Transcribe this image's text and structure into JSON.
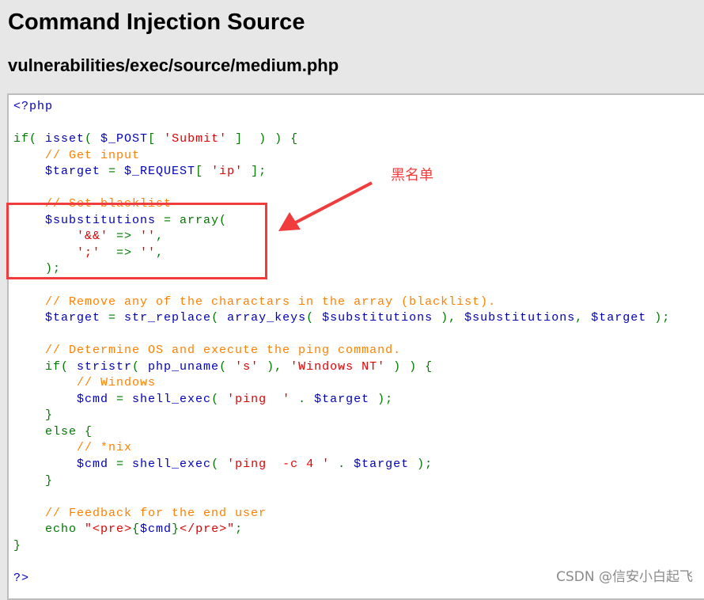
{
  "page": {
    "title": "Command Injection Source",
    "subtitle": "vulnerabilities/exec/source/medium.php"
  },
  "colors": {
    "keyword": "#007700",
    "default": "#0000bb",
    "string": "#dd0000",
    "comment": "#ff8000",
    "annotation": "#f03c3c"
  },
  "code": [
    [
      [
        "<?php",
        "blue"
      ]
    ],
    [],
    [
      [
        "if( ",
        "green"
      ],
      [
        "isset",
        "blue"
      ],
      [
        "( ",
        "green"
      ],
      [
        "$_POST",
        "blue"
      ],
      [
        "[ ",
        "green"
      ],
      [
        "'Submit'",
        "red"
      ],
      [
        " ]  ) ) {",
        "green"
      ]
    ],
    [
      [
        "    // Get input",
        "orange"
      ]
    ],
    [
      [
        "    $target ",
        "blue"
      ],
      [
        "= ",
        "green"
      ],
      [
        "$_REQUEST",
        "blue"
      ],
      [
        "[ ",
        "green"
      ],
      [
        "'ip'",
        "red"
      ],
      [
        " ];",
        "green"
      ]
    ],
    [],
    [
      [
        "    // Set blacklist",
        "orange"
      ]
    ],
    [
      [
        "    $substitutions ",
        "blue"
      ],
      [
        "= array(",
        "green"
      ]
    ],
    [
      [
        "        '&&' ",
        "red"
      ],
      [
        "=> ",
        "green"
      ],
      [
        "''",
        "red"
      ],
      [
        ",",
        "green"
      ]
    ],
    [
      [
        "        ';'  ",
        "red"
      ],
      [
        "=> ",
        "green"
      ],
      [
        "''",
        "red"
      ],
      [
        ",",
        "green"
      ]
    ],
    [
      [
        "    );",
        "green"
      ]
    ],
    [],
    [
      [
        "    // Remove any of the charactars in the array (blacklist).",
        "orange"
      ]
    ],
    [
      [
        "    $target ",
        "blue"
      ],
      [
        "= ",
        "green"
      ],
      [
        "str_replace",
        "blue"
      ],
      [
        "( ",
        "green"
      ],
      [
        "array_keys",
        "blue"
      ],
      [
        "( ",
        "green"
      ],
      [
        "$substitutions ",
        "blue"
      ],
      [
        "), ",
        "green"
      ],
      [
        "$substitutions",
        "blue"
      ],
      [
        ", ",
        "green"
      ],
      [
        "$target ",
        "blue"
      ],
      [
        ");",
        "green"
      ]
    ],
    [],
    [
      [
        "    // Determine OS and execute the ping command.",
        "orange"
      ]
    ],
    [
      [
        "    if( ",
        "green"
      ],
      [
        "stristr",
        "blue"
      ],
      [
        "( ",
        "green"
      ],
      [
        "php_uname",
        "blue"
      ],
      [
        "( ",
        "green"
      ],
      [
        "'s' ",
        "red"
      ],
      [
        "), ",
        "green"
      ],
      [
        "'Windows NT' ",
        "red"
      ],
      [
        ") ) {",
        "green"
      ]
    ],
    [
      [
        "        // Windows",
        "orange"
      ]
    ],
    [
      [
        "        $cmd ",
        "blue"
      ],
      [
        "= ",
        "green"
      ],
      [
        "shell_exec",
        "blue"
      ],
      [
        "( ",
        "green"
      ],
      [
        "'ping  ' ",
        "red"
      ],
      [
        ". ",
        "green"
      ],
      [
        "$target ",
        "blue"
      ],
      [
        ");",
        "green"
      ]
    ],
    [
      [
        "    }",
        "green"
      ]
    ],
    [
      [
        "    else {",
        "green"
      ]
    ],
    [
      [
        "        // *nix",
        "orange"
      ]
    ],
    [
      [
        "        $cmd ",
        "blue"
      ],
      [
        "= ",
        "green"
      ],
      [
        "shell_exec",
        "blue"
      ],
      [
        "( ",
        "green"
      ],
      [
        "'ping  -c 4 ' ",
        "red"
      ],
      [
        ". ",
        "green"
      ],
      [
        "$target ",
        "blue"
      ],
      [
        ");",
        "green"
      ]
    ],
    [
      [
        "    }",
        "green"
      ]
    ],
    [],
    [
      [
        "    // Feedback for the end user",
        "orange"
      ]
    ],
    [
      [
        "    echo ",
        "green"
      ],
      [
        "\"<pre>",
        "red"
      ],
      [
        "{",
        "green"
      ],
      [
        "$cmd",
        "blue"
      ],
      [
        "}",
        "green"
      ],
      [
        "</pre>\"",
        "red"
      ],
      [
        ";",
        "green"
      ]
    ],
    [
      [
        "}",
        "green"
      ]
    ],
    [],
    [
      [
        "?>",
        "blue"
      ]
    ]
  ],
  "annotation": {
    "label": "黑名单"
  },
  "watermark": "CSDN @信安小白起飞"
}
